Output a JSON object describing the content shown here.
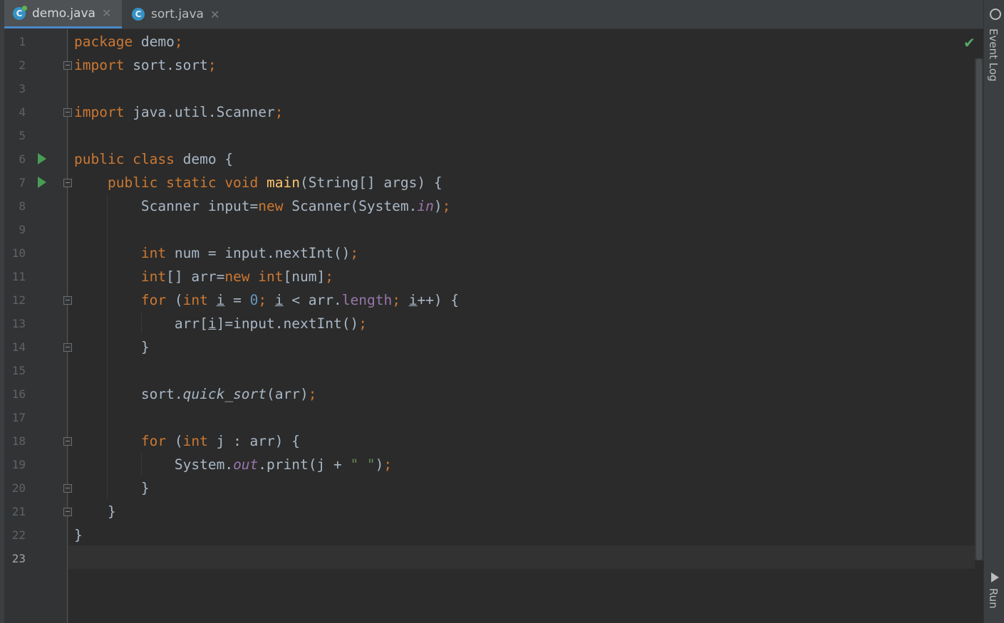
{
  "tabs": [
    {
      "label": "demo.java",
      "icon": "java-class-icon",
      "active": true
    },
    {
      "label": "sort.java",
      "icon": "java-class-icon",
      "active": false
    }
  ],
  "tool_windows": {
    "event_log": "Event Log",
    "run": "Run"
  },
  "editor": {
    "current_line": 23,
    "line_numbers": [
      "1",
      "2",
      "3",
      "4",
      "5",
      "6",
      "7",
      "8",
      "9",
      "10",
      "11",
      "12",
      "13",
      "14",
      "15",
      "16",
      "17",
      "18",
      "19",
      "20",
      "21",
      "22",
      "23"
    ],
    "code": {
      "l1": {
        "a": "package",
        "b": " demo",
        "c": ";"
      },
      "l2": {
        "a": "import",
        "b": " sort.sort",
        "c": ";"
      },
      "l4": {
        "a": "import",
        "b": " java.util.Scanner",
        "c": ";"
      },
      "l6": {
        "a": "public class",
        "b": " demo {"
      },
      "l7": {
        "a": "    public static void ",
        "b": "main",
        "c": "(String[] args) {"
      },
      "l8": {
        "a": "        Scanner input=",
        "b": "new",
        "c": " Scanner(System.",
        "d": "in",
        "e": ")",
        "f": ";"
      },
      "l10": {
        "a": "        int",
        "b": " num = input.nextInt()",
        "c": ";"
      },
      "l11": {
        "a": "        int",
        "b": "[] arr=",
        "c": "new int",
        "d": "[num]",
        "e": ";"
      },
      "l12": {
        "a": "        for",
        "b": " (",
        "c": "int",
        "d": " ",
        "e": "i",
        "f": " = ",
        "g": "0",
        "h": "; ",
        "i": "i",
        "j": " < arr.",
        "k": "length",
        "l": "; ",
        "m": "i",
        "n": "++) {"
      },
      "l13": {
        "a": "            arr[",
        "b": "i",
        "c": "]=input.nextInt()",
        "d": ";"
      },
      "l14": {
        "a": "        }"
      },
      "l16": {
        "a": "        sort.",
        "b": "quick_sort",
        "c": "(arr)",
        "d": ";"
      },
      "l18": {
        "a": "        for",
        "b": " (",
        "c": "int",
        "d": " j : arr) {"
      },
      "l19": {
        "a": "            System.",
        "b": "out",
        "c": ".print(j + ",
        "d": "\" \"",
        "e": ")",
        "f": ";"
      },
      "l20": {
        "a": "        }"
      },
      "l21": {
        "a": "    }"
      },
      "l22": {
        "a": "}"
      }
    }
  },
  "colors": {
    "keyword": "#cc7832",
    "number": "#6897bb",
    "string": "#6a8759",
    "field": "#9876aa",
    "method_decl": "#ffc66d",
    "text": "#a9b7c6",
    "background": "#2b2b2b",
    "run_icon": "#499c54",
    "check": "#59a869"
  },
  "status": {
    "inspection_icon": "check-icon"
  }
}
